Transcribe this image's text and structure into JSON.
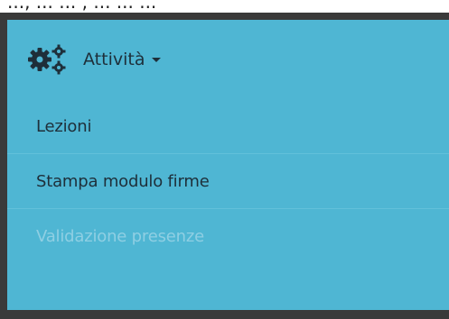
{
  "top_fragment": "..., ... ... , ... ... ...",
  "menu": {
    "header_label": "Attività",
    "header_icon": "gears-icon",
    "caret_icon": "caret-down-icon",
    "items": [
      {
        "label": "Lezioni",
        "enabled": true
      },
      {
        "label": "Stampa modulo firme",
        "enabled": true
      },
      {
        "label": "Validazione presenze",
        "enabled": false
      }
    ]
  },
  "colors": {
    "panel": "#4fb6d3",
    "text": "#1e2f3a",
    "disabled_text": "#8fcfe3",
    "frame": "#3a3a3a"
  }
}
